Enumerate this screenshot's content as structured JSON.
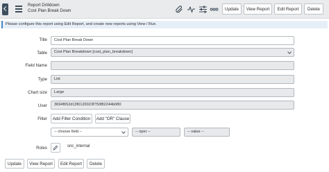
{
  "header": {
    "title": "Report Drilldown",
    "subtitle": "Cost Plan Break Down",
    "buttons": {
      "update": "Update",
      "view_report": "View Report",
      "edit_report": "Edit Report",
      "delete": "Delete"
    },
    "icons": [
      "paperclip-icon",
      "activity-icon",
      "settings-sliders-icon",
      "more-options-icon"
    ]
  },
  "info_message": "Please configure this report using Edit Report, and create new reports using View / Run.",
  "form": {
    "title": {
      "label": "Title",
      "value": "Cost Plan Break Down"
    },
    "table": {
      "label": "Table",
      "value": "Cost Plan Breakdown [cost_plan_breakdown]"
    },
    "field_name": {
      "label": "Field Name",
      "value": ""
    },
    "type": {
      "label": "Type",
      "value": "List"
    },
    "chart_size": {
      "label": "Chart size",
      "value": "Large"
    },
    "user": {
      "label": "User",
      "value": "3694f652d13f0120023f750f82244b080"
    },
    "filter": {
      "label": "Filter",
      "add_filter_condition": "Add Filter Condition",
      "add_or_clause": "Add \"OR\" Clause",
      "field_select": "-- choose field --",
      "oper_select": "-- oper --",
      "value_select": "-- value --"
    },
    "roles": {
      "label": "Roles",
      "value": "snc_internal"
    }
  },
  "footer_buttons": {
    "update": "Update",
    "view_report": "View Report",
    "edit_report": "Edit Report",
    "delete": "Delete"
  },
  "colors": {
    "header_bg": "#e9ebed",
    "info_bg": "#e6eef7",
    "info_accent": "#4a86c5",
    "readonly_field_bg": "#e7e9eb"
  }
}
